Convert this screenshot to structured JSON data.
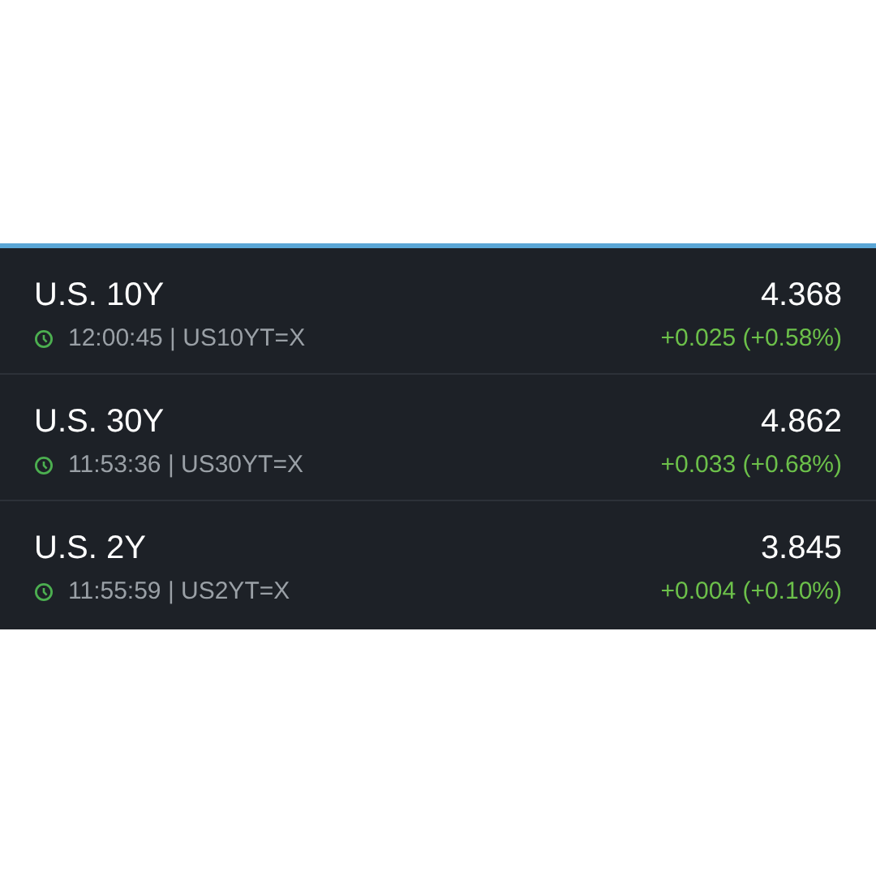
{
  "quotes": [
    {
      "name": "U.S. 10Y",
      "time": "12:00:45 | US10YT=X",
      "price": "4.368",
      "change": "+0.025 (+0.58%)",
      "color": "#6cc04a"
    },
    {
      "name": "U.S. 30Y",
      "time": "11:53:36 | US30YT=X",
      "price": "4.862",
      "change": "+0.033 (+0.68%)",
      "color": "#6cc04a"
    },
    {
      "name": "U.S. 2Y",
      "time": "11:55:59 | US2YT=X",
      "price": "3.845",
      "change": "+0.004 (+0.10%)",
      "color": "#6cc04a"
    }
  ]
}
